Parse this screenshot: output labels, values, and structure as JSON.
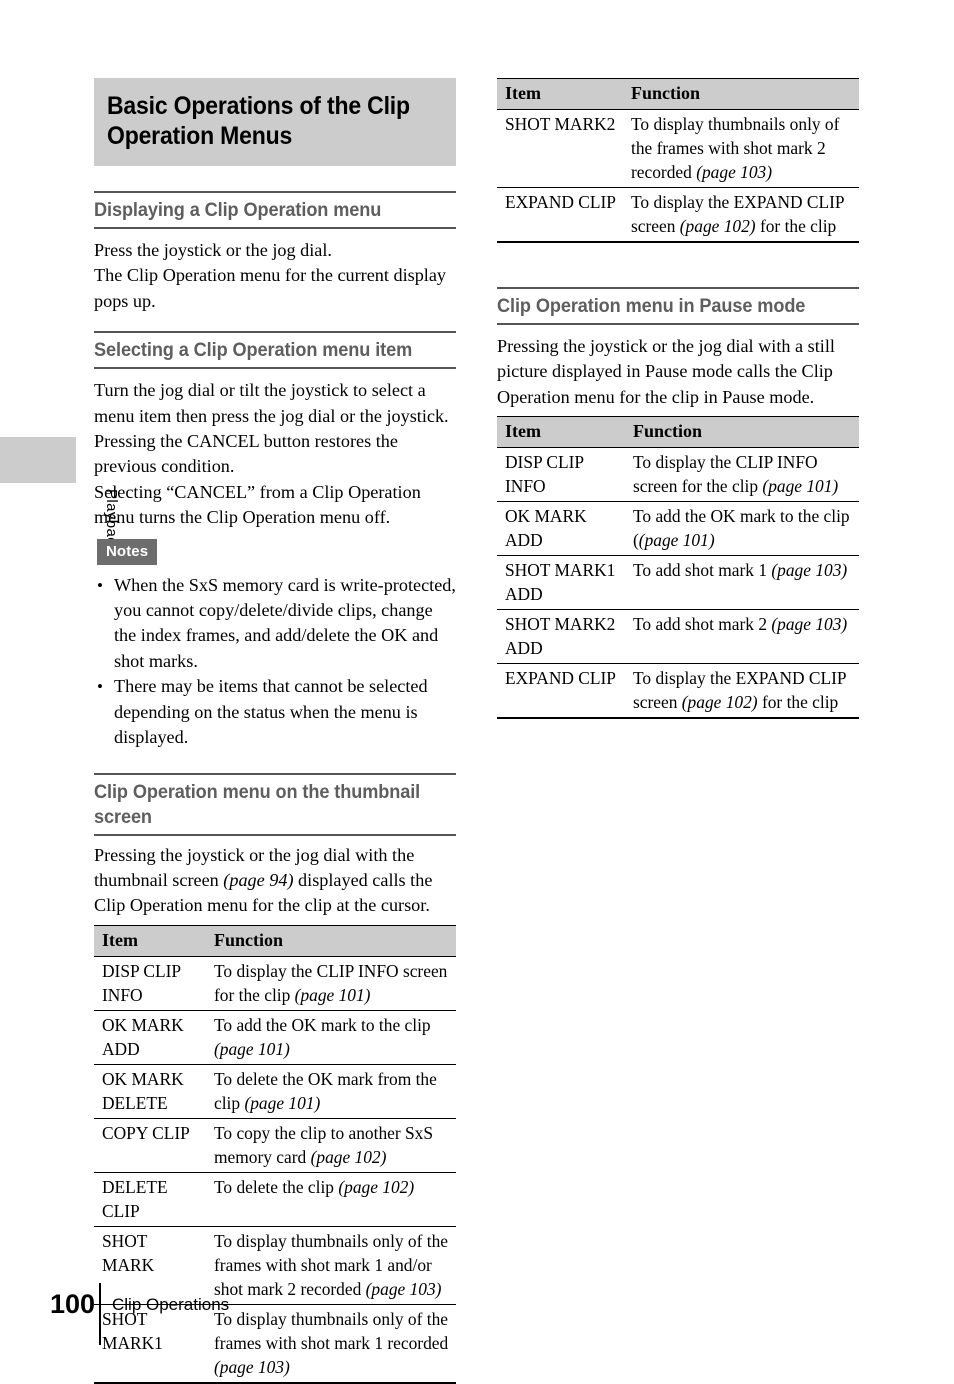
{
  "side_tab": {
    "label": "Playback"
  },
  "chapter": {
    "title_line1": "Basic Operations of the Clip",
    "title_line2": "Operation Menus"
  },
  "sections": {
    "displaying": {
      "heading": "Displaying a Clip Operation menu",
      "para1": "Press the joystick or the jog dial.",
      "para2": "The Clip Operation menu for the current display pops up."
    },
    "selecting": {
      "heading": "Selecting a Clip Operation menu item",
      "para1": "Turn the jog dial or tilt the joystick to select a menu item then press the jog dial or the joystick.",
      "para2": "Pressing the CANCEL button restores the previous condition.",
      "para3": "Selecting “CANCEL” from a Clip Operation menu turns the Clip Operation menu off.",
      "notes_badge": "Notes",
      "note1": "When the SxS memory card is write-protected, you cannot copy/delete/divide clips, change the index frames, and add/delete the OK and shot marks.",
      "note2": "There may be items that cannot be selected depending on the status when the menu is displayed."
    },
    "thumbnail": {
      "heading_line1": "Clip Operation menu on the thumbnail",
      "heading_line2": "screen",
      "intro_a": "Pressing the joystick or the jog dial with the thumbnail screen ",
      "intro_page": "(page 94)",
      "intro_b": " displayed calls the Clip Operation menu for the clip at the cursor."
    },
    "pause": {
      "heading": "Clip Operation menu in Pause mode",
      "intro": "Pressing the joystick or the jog dial with a still picture displayed in Pause mode calls the Clip Operation menu for the clip in Pause mode."
    }
  },
  "table_headers": {
    "item": "Item",
    "function": "Function"
  },
  "thumbnail_table": {
    "rows": [
      {
        "item": "DISP CLIP INFO",
        "fn_a": "To display the CLIP INFO screen for the clip ",
        "fn_page": "(page 101)",
        "fn_b": ""
      },
      {
        "item": "OK MARK ADD",
        "fn_a": "To add the OK mark to the clip ",
        "fn_page": "(page 101)",
        "fn_b": ""
      },
      {
        "item": "OK MARK DELETE",
        "fn_a": "To delete the OK mark from the clip ",
        "fn_page": "(page 101)",
        "fn_b": ""
      },
      {
        "item": "COPY CLIP",
        "fn_a": "To copy the clip to another SxS memory card ",
        "fn_page": "(page 102)",
        "fn_b": ""
      },
      {
        "item": "DELETE CLIP",
        "fn_a": "To delete the clip ",
        "fn_page": "(page 102)",
        "fn_b": ""
      },
      {
        "item": "SHOT MARK",
        "fn_a": "To display thumbnails only of the frames with shot mark 1 and/or shot mark 2 recorded ",
        "fn_page": "(page 103)",
        "fn_b": ""
      },
      {
        "item": "SHOT MARK1",
        "fn_a": "To display thumbnails only of the frames with shot mark 1 recorded ",
        "fn_page": "(page 103)",
        "fn_b": ""
      }
    ],
    "continued_rows": [
      {
        "item": "SHOT MARK2",
        "fn_a": "To display thumbnails only of the frames with shot mark 2 recorded ",
        "fn_page": "(page 103)",
        "fn_b": ""
      },
      {
        "item": "EXPAND CLIP",
        "fn_a": "To display the EXPAND CLIP screen ",
        "fn_page": "(page 102)",
        "fn_b": " for the clip"
      }
    ]
  },
  "pause_table": {
    "rows": [
      {
        "item": "DISP CLIP INFO",
        "fn_a": "To display the CLIP INFO screen for the clip ",
        "fn_page": "(page 101)",
        "fn_b": ""
      },
      {
        "item": "OK MARK ADD",
        "fn_a": "To add the OK mark to the clip (",
        "fn_page": "(page 101)",
        "fn_b": ""
      },
      {
        "item": "SHOT MARK1 ADD",
        "fn_a": "To add shot mark 1 ",
        "fn_page": "(page 103)",
        "fn_b": ""
      },
      {
        "item": "SHOT MARK2 ADD",
        "fn_a": "To add shot mark 2 ",
        "fn_page": "(page 103)",
        "fn_b": ""
      },
      {
        "item": "EXPAND CLIP",
        "fn_a": "To display the EXPAND CLIP screen ",
        "fn_page": "(page 102)",
        "fn_b": " for the clip"
      }
    ]
  },
  "footer": {
    "page_number": "100",
    "label": "Clip Operations"
  }
}
